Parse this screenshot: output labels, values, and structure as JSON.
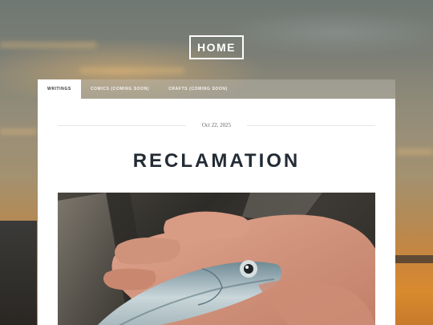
{
  "header": {
    "home_label": "HOME"
  },
  "tabs": [
    {
      "label": "WRITINGS",
      "active": true
    },
    {
      "label": "COMICS (COMING SOON)",
      "active": false
    },
    {
      "label": "CRAFTS (COMING SOON)",
      "active": false
    }
  ],
  "post": {
    "date": "Oct 22, 2025",
    "title": "RECLAMATION",
    "image_icon": "fish-in-hand-photo"
  },
  "colors": {
    "title": "#232b35",
    "card_bg": "#ffffff",
    "sky_top": "#6f7873",
    "sky_bottom": "#d98a2e"
  }
}
